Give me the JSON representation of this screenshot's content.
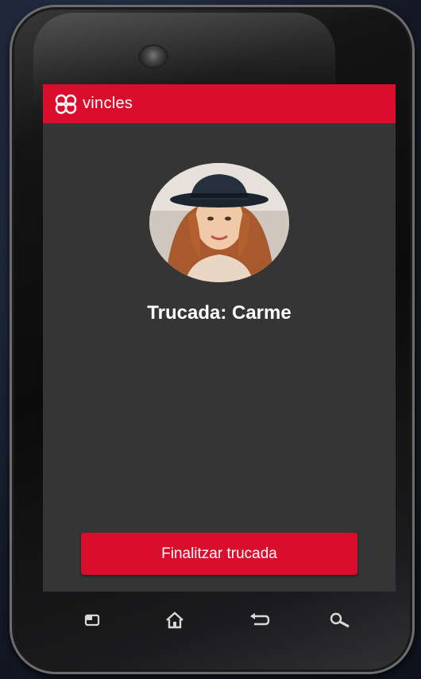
{
  "app": {
    "name": "vincles",
    "logo_icon": "vincles-knot-logo-icon",
    "accent_color": "#d80e2c"
  },
  "call": {
    "caller_avatar": "caller-photo-avatar",
    "title": "Trucada: Carme",
    "end_button_label": "Finalitzar trucada"
  },
  "device": {
    "nav_keys": [
      "menu-icon",
      "home-icon",
      "back-icon",
      "search-icon"
    ]
  }
}
